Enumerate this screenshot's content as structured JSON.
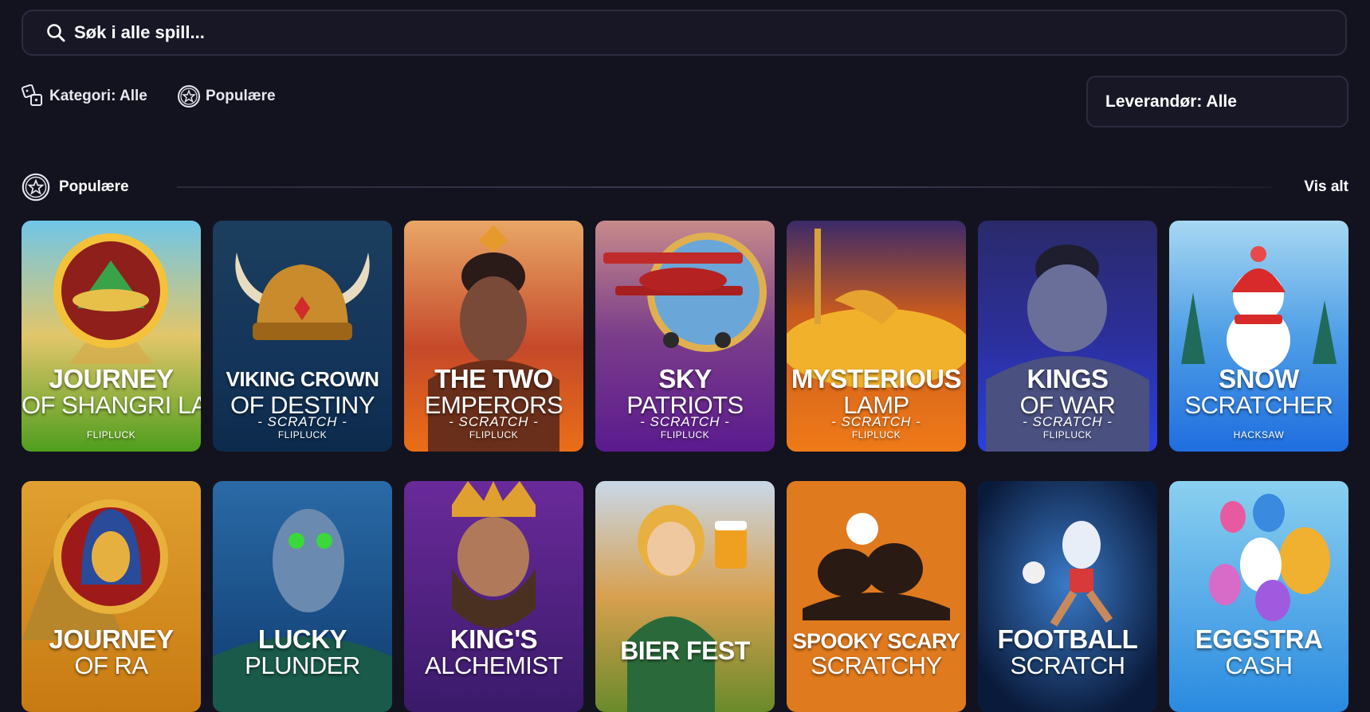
{
  "search": {
    "placeholder": "Søk i alle spill..."
  },
  "filters": {
    "category_label": "Kategori: Alle",
    "popular_label": "Populære"
  },
  "provider_select": {
    "label": "Leverandør: Alle"
  },
  "section": {
    "title": "Populære",
    "view_all": "Vis alt"
  },
  "games_row1": [
    {
      "title1": "JOURNEY",
      "title2": "OF SHANGRI LA",
      "subtitle": "",
      "provider": "FLIPLUCK"
    },
    {
      "title1": "VIKING CROWN",
      "title2": "OF DESTINY",
      "subtitle": "- SCRATCH -",
      "provider": "FLIPLUCK"
    },
    {
      "title1": "THE TWO",
      "title2": "EMPERORS",
      "subtitle": "- SCRATCH -",
      "provider": "FLIPLUCK"
    },
    {
      "title1": "SKY",
      "title2": "PATRIOTS",
      "subtitle": "- SCRATCH -",
      "provider": "FLIPLUCK"
    },
    {
      "title1": "MYSTERIOUS",
      "title2": "LAMP",
      "subtitle": "- SCRATCH -",
      "provider": "FLIPLUCK"
    },
    {
      "title1": "KINGS",
      "title2": "OF WAR",
      "subtitle": "- SCRATCH -",
      "provider": "FLIPLUCK"
    },
    {
      "title1": "SNOW",
      "title2": "SCRATCHER",
      "subtitle": "",
      "provider": "HACKSAW"
    }
  ],
  "games_row2": [
    {
      "title1": "JOURNEY",
      "title2": "OF RA"
    },
    {
      "title1": "LUCKY",
      "title2": "PLUNDER"
    },
    {
      "title1": "KING'S",
      "title2": "ALCHEMIST"
    },
    {
      "title1": "BIER FEST",
      "title2": ""
    },
    {
      "title1": "SPOOKY SCARY",
      "title2": "SCRATCHY"
    },
    {
      "title1": "FOOTBALL",
      "title2": "SCRATCH"
    },
    {
      "title1": "EGGSTRA",
      "title2": "CASH"
    }
  ],
  "icons": {
    "search": "magnifier-icon",
    "category": "dice-icon",
    "popular": "star-circle-icon"
  }
}
